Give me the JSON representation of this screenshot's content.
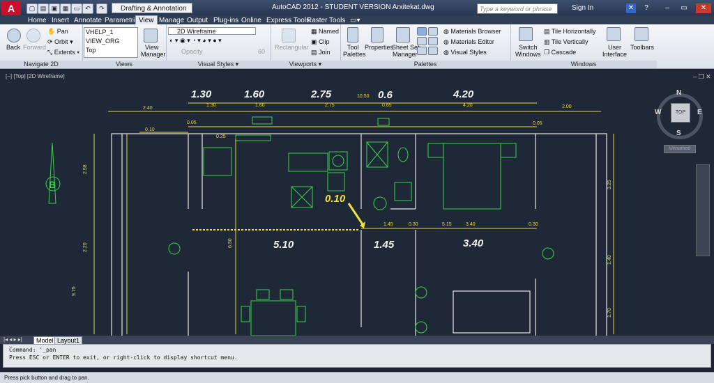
{
  "window": {
    "title": "AutoCAD 2012 - STUDENT VERSION    Arxitekat.dwg",
    "app_logo": "A",
    "workspace": "Drafting & Annotation",
    "search_placeholder": "Type a keyword or phrase",
    "sign_in": "Sign In"
  },
  "tabs": [
    "Home",
    "Insert",
    "Annotate",
    "Parametric",
    "View",
    "Manage",
    "Output",
    "Plug-ins",
    "Online",
    "Express Tools",
    "Raster Tools"
  ],
  "active_tab": "View",
  "ribbon": {
    "navigate": {
      "title": "Navigate 2D",
      "back": "Back",
      "forward": "Forward",
      "pan": "Pan",
      "orbit": "Orbit",
      "extents": "Extents"
    },
    "views": {
      "title": "Views",
      "items": [
        "VHELP_1",
        "VIEW_ORG",
        "Top"
      ],
      "view_manager_1": "View",
      "view_manager_2": "Manager"
    },
    "visual_styles": {
      "title": "Visual Styles",
      "style": "2D Wireframe",
      "opacity": "Opacity",
      "opacity_value": "60"
    },
    "viewports": {
      "title": "Viewports",
      "rectangular": "Rectangular",
      "named": "Named",
      "clip": "Clip",
      "join": "Join"
    },
    "palettes": {
      "title": "Palettes",
      "tool_1": "Tool",
      "tool_2": "Palettes",
      "properties": "Properties",
      "sheet_1": "Sheet Set",
      "sheet_2": "Manager",
      "materials_browser": "Materials Browser",
      "materials_editor": "Materials Editor",
      "visual_styles": "Visual Styles"
    },
    "windows": {
      "title": "Windows",
      "switch_1": "Switch",
      "switch_2": "Windows",
      "tile_h": "Tile Horizontally",
      "tile_v": "Tile Vertically",
      "cascade": "Cascade",
      "ui_1": "User",
      "ui_2": "Interface",
      "toolbars": "Toolbars"
    }
  },
  "viewport_label": "[−] [Top] [2D Wireframe]",
  "viewcube": {
    "n": "N",
    "s": "S",
    "e": "E",
    "w": "W",
    "face": "TOP",
    "ucs": "Unnamed"
  },
  "drawing": {
    "big_dims_top": [
      "1.30",
      "1.60",
      "2.75",
      "0.6",
      "4.20"
    ],
    "small_dims_top": [
      "2.40",
      "1.30",
      "1.60",
      "2.75",
      "10.50",
      "0.65",
      "4.20",
      "2.00"
    ],
    "misc": [
      "0.10",
      "0.05",
      "0.25",
      "0.05"
    ],
    "big_dims_mid": [
      "5.10",
      "1.45",
      "3.40"
    ],
    "small_dims_mid": [
      "1.45",
      "0.30",
      "5.15",
      "3.40",
      "0.30"
    ],
    "leader_value": "0.10",
    "left_dims": [
      "2.58",
      "2.20",
      "9.75",
      "6.50"
    ],
    "right_dims": [
      "3.25",
      "1.40",
      "1.70"
    ],
    "north_arrow": "B"
  },
  "layout_tabs": [
    "Model",
    "Layout1"
  ],
  "command": {
    "line1": "Command: '_pan",
    "line2": "Press ESC or ENTER to exit, or right-click to display shortcut menu."
  },
  "status": "Press pick button and drag to pan."
}
